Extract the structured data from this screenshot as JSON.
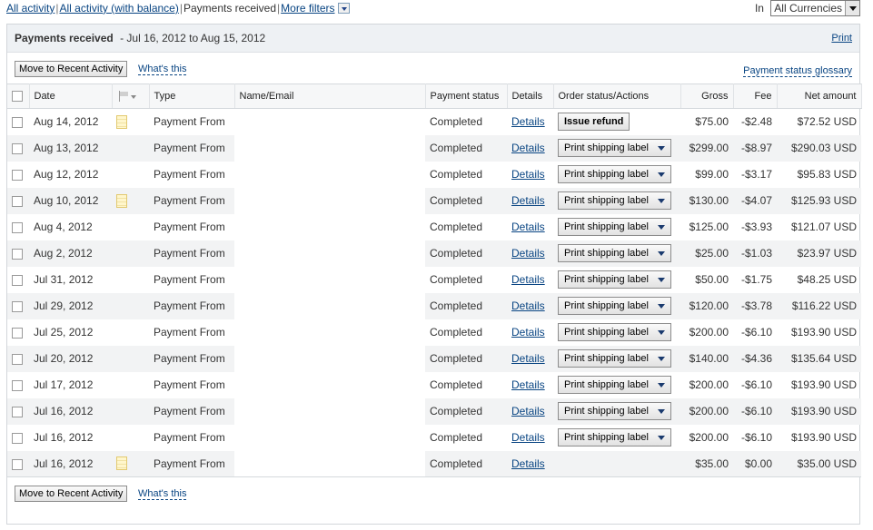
{
  "filters": {
    "all_activity": "All activity",
    "all_activity_balance": "All activity (with balance)",
    "payments_received": "Payments received",
    "more_filters": "More filters"
  },
  "currency": {
    "label": "In",
    "selected": "All Currencies"
  },
  "panel": {
    "title": "Payments received",
    "range": "- Jul 16, 2012 to Aug 15, 2012",
    "print": "Print"
  },
  "toolbar": {
    "move_button": "Move to Recent Activity",
    "whats_this": "What's this",
    "glossary": "Payment status glossary"
  },
  "columns": {
    "date": "Date",
    "type": "Type",
    "name_email": "Name/Email",
    "payment_status": "Payment status",
    "details": "Details",
    "order_status": "Order status/Actions",
    "gross": "Gross",
    "fee": "Fee",
    "net": "Net amount"
  },
  "rows": [
    {
      "date": "Aug 14, 2012",
      "note": true,
      "type": "Payment From",
      "status": "Completed",
      "details": "Details",
      "action": "Issue refund",
      "gross": "$75.00",
      "fee": "-$2.48",
      "net": "$72.52 USD"
    },
    {
      "date": "Aug 13, 2012",
      "note": false,
      "type": "Payment From",
      "status": "Completed",
      "details": "Details",
      "action": "Print shipping label",
      "gross": "$299.00",
      "fee": "-$8.97",
      "net": "$290.03 USD"
    },
    {
      "date": "Aug 12, 2012",
      "note": false,
      "type": "Payment From",
      "status": "Completed",
      "details": "Details",
      "action": "Print shipping label",
      "gross": "$99.00",
      "fee": "-$3.17",
      "net": "$95.83 USD"
    },
    {
      "date": "Aug 10, 2012",
      "note": true,
      "type": "Payment From",
      "status": "Completed",
      "details": "Details",
      "action": "Print shipping label",
      "gross": "$130.00",
      "fee": "-$4.07",
      "net": "$125.93 USD"
    },
    {
      "date": "Aug 4, 2012",
      "note": false,
      "type": "Payment From",
      "status": "Completed",
      "details": "Details",
      "action": "Print shipping label",
      "gross": "$125.00",
      "fee": "-$3.93",
      "net": "$121.07 USD"
    },
    {
      "date": "Aug 2, 2012",
      "note": false,
      "type": "Payment From",
      "status": "Completed",
      "details": "Details",
      "action": "Print shipping label",
      "gross": "$25.00",
      "fee": "-$1.03",
      "net": "$23.97 USD"
    },
    {
      "date": "Jul 31, 2012",
      "note": false,
      "type": "Payment From",
      "status": "Completed",
      "details": "Details",
      "action": "Print shipping label",
      "gross": "$50.00",
      "fee": "-$1.75",
      "net": "$48.25 USD"
    },
    {
      "date": "Jul 29, 2012",
      "note": false,
      "type": "Payment From",
      "status": "Completed",
      "details": "Details",
      "action": "Print shipping label",
      "gross": "$120.00",
      "fee": "-$3.78",
      "net": "$116.22 USD"
    },
    {
      "date": "Jul 25, 2012",
      "note": false,
      "type": "Payment From",
      "status": "Completed",
      "details": "Details",
      "action": "Print shipping label",
      "gross": "$200.00",
      "fee": "-$6.10",
      "net": "$193.90 USD"
    },
    {
      "date": "Jul 20, 2012",
      "note": false,
      "type": "Payment From",
      "status": "Completed",
      "details": "Details",
      "action": "Print shipping label",
      "gross": "$140.00",
      "fee": "-$4.36",
      "net": "$135.64 USD"
    },
    {
      "date": "Jul 17, 2012",
      "note": false,
      "type": "Payment From",
      "status": "Completed",
      "details": "Details",
      "action": "Print shipping label",
      "gross": "$200.00",
      "fee": "-$6.10",
      "net": "$193.90 USD"
    },
    {
      "date": "Jul 16, 2012",
      "note": false,
      "type": "Payment From",
      "status": "Completed",
      "details": "Details",
      "action": "Print shipping label",
      "gross": "$200.00",
      "fee": "-$6.10",
      "net": "$193.90 USD"
    },
    {
      "date": "Jul 16, 2012",
      "note": false,
      "type": "Payment From",
      "status": "Completed",
      "details": "Details",
      "action": "Print shipping label",
      "gross": "$200.00",
      "fee": "-$6.10",
      "net": "$193.90 USD"
    },
    {
      "date": "Jul 16, 2012",
      "note": true,
      "type": "Payment From",
      "status": "Completed",
      "details": "Details",
      "action": "",
      "gross": "$35.00",
      "fee": "$0.00",
      "net": "$35.00 USD"
    }
  ],
  "footer": {
    "move_button": "Move to Recent Activity",
    "whats_this": "What's this"
  }
}
